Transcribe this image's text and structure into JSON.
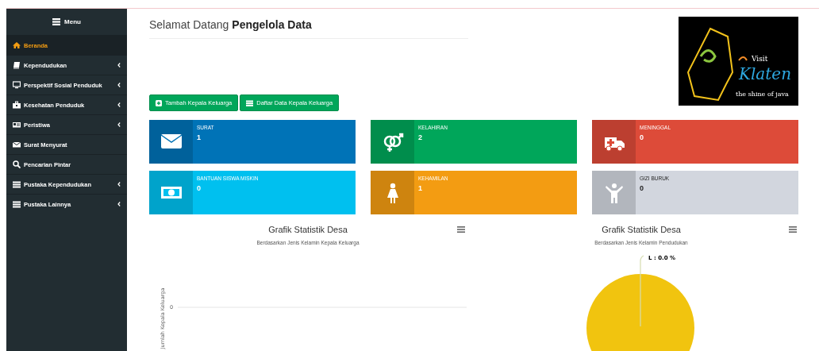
{
  "sidebar": {
    "header": "Menu",
    "items": [
      {
        "label": "Beranda",
        "selected": true,
        "expandable": false
      },
      {
        "label": "Kependudukan",
        "selected": false,
        "expandable": true
      },
      {
        "label": "Perspektif Sosial Penduduk",
        "selected": false,
        "expandable": true
      },
      {
        "label": "Kesehatan Penduduk",
        "selected": false,
        "expandable": true
      },
      {
        "label": "Peristiwa",
        "selected": false,
        "expandable": true
      },
      {
        "label": "Surat Menyurat",
        "selected": false,
        "expandable": false
      },
      {
        "label": "Pencarian Pintar",
        "selected": false,
        "expandable": false
      },
      {
        "label": "Pustaka Kependudukan",
        "selected": false,
        "expandable": true
      },
      {
        "label": "Pustaka Lainnya",
        "selected": false,
        "expandable": true
      }
    ]
  },
  "header": {
    "greeting": "Selamat Datang",
    "role": "Pengelola Data"
  },
  "logo": {
    "line1": "Visit",
    "line2": "Klaten",
    "tagline": "the shine of java"
  },
  "buttons": [
    {
      "label": "Tambah Kepala Keluarga"
    },
    {
      "label": "Daftar Data Kepala Keluarga"
    }
  ],
  "info_boxes": [
    {
      "label": "SURAT",
      "value": "1",
      "color": "#0073b7"
    },
    {
      "label": "KELAHIRAN",
      "value": "2",
      "color": "#00a65a"
    },
    {
      "label": "MENINGGAL",
      "value": "0",
      "color": "#dd4b39"
    },
    {
      "label": "BANTUAN SISWA MISKIN",
      "value": "0",
      "color": "#00c0ef"
    },
    {
      "label": "KEHAMILAN",
      "value": "1",
      "color": "#f39c12"
    },
    {
      "label": "GIZI BURUK",
      "value": "0",
      "color": "#d2d6de"
    }
  ],
  "charts": [
    {
      "kind": "axis",
      "title": "Grafik Statistik Desa",
      "subtitle": "Berdasarkan Jenis Kelamin Kepala Keluarga",
      "y_axis_title": "Jumlah Kepala Keluarga",
      "y_tick": "0"
    },
    {
      "kind": "pie",
      "title": "Grafik Statistik Desa",
      "subtitle": "Berdasarkan Jenis Kelamin Pendudukan",
      "slice_label": "L : 0.0 %"
    }
  ]
}
